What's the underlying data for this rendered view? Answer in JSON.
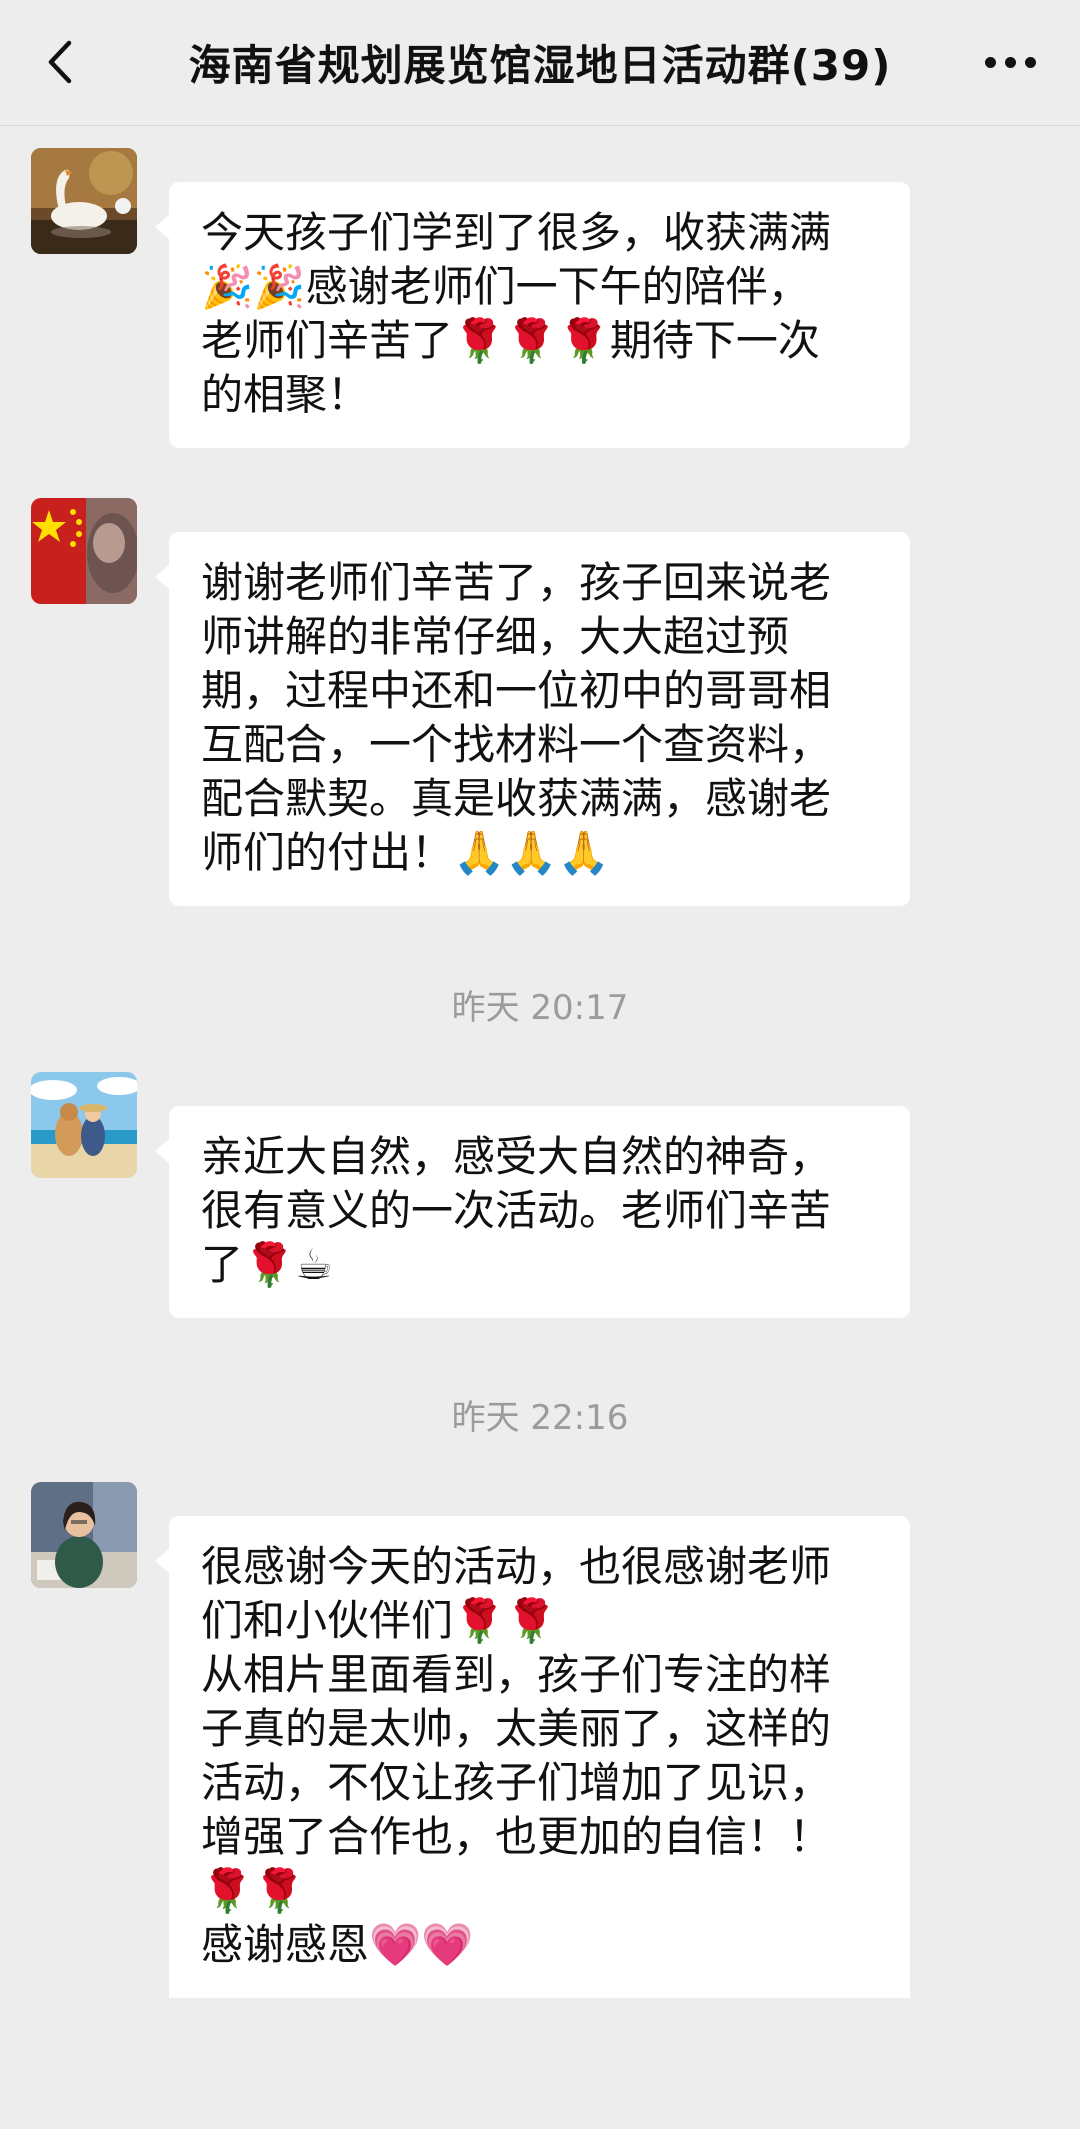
{
  "header": {
    "title": "海南省规划展览馆湿地日活动群(39)",
    "back_icon": "chevron-left-icon",
    "more_icon": "more-dots-icon"
  },
  "messages": [
    {
      "avatar": "swan-avatar",
      "lines": [
        "今天孩子们学到了很多，收获满满",
        "🎉🎉感谢老师们一下午的陪伴，",
        "老师们辛苦了🌹🌹🌹期待下一次",
        "的相聚！"
      ]
    },
    {
      "avatar": "flag-avatar",
      "lines": [
        "谢谢老师们辛苦了，孩子回来说老",
        "师讲解的非常仔细，大大超过预",
        "期，过程中还和一位初中的哥哥相",
        "互配合，一个找材料一个查资料，",
        "配合默契。真是收获满满，感谢老",
        "师们的付出！🙏🙏🙏"
      ]
    },
    {
      "avatar": "beach-avatar",
      "lines": [
        "亲近大自然，感受大自然的神奇，",
        "很有意义的一次活动。老师们辛苦",
        "了🌹☕"
      ]
    },
    {
      "avatar": "woman-avatar",
      "lines": [
        "很感谢今天的活动，也很感谢老师",
        "们和小伙伴们🌹🌹",
        "从相片里面看到，孩子们专注的样",
        "子真的是太帅，太美丽了，这样的",
        "活动，不仅让孩子们增加了见识，",
        "增强了合作也，也更加的自信！！",
        "🌹🌹",
        "感谢感恩💗💗"
      ]
    }
  ],
  "timestamps": [
    "昨天 20:17",
    "昨天 22:16"
  ]
}
